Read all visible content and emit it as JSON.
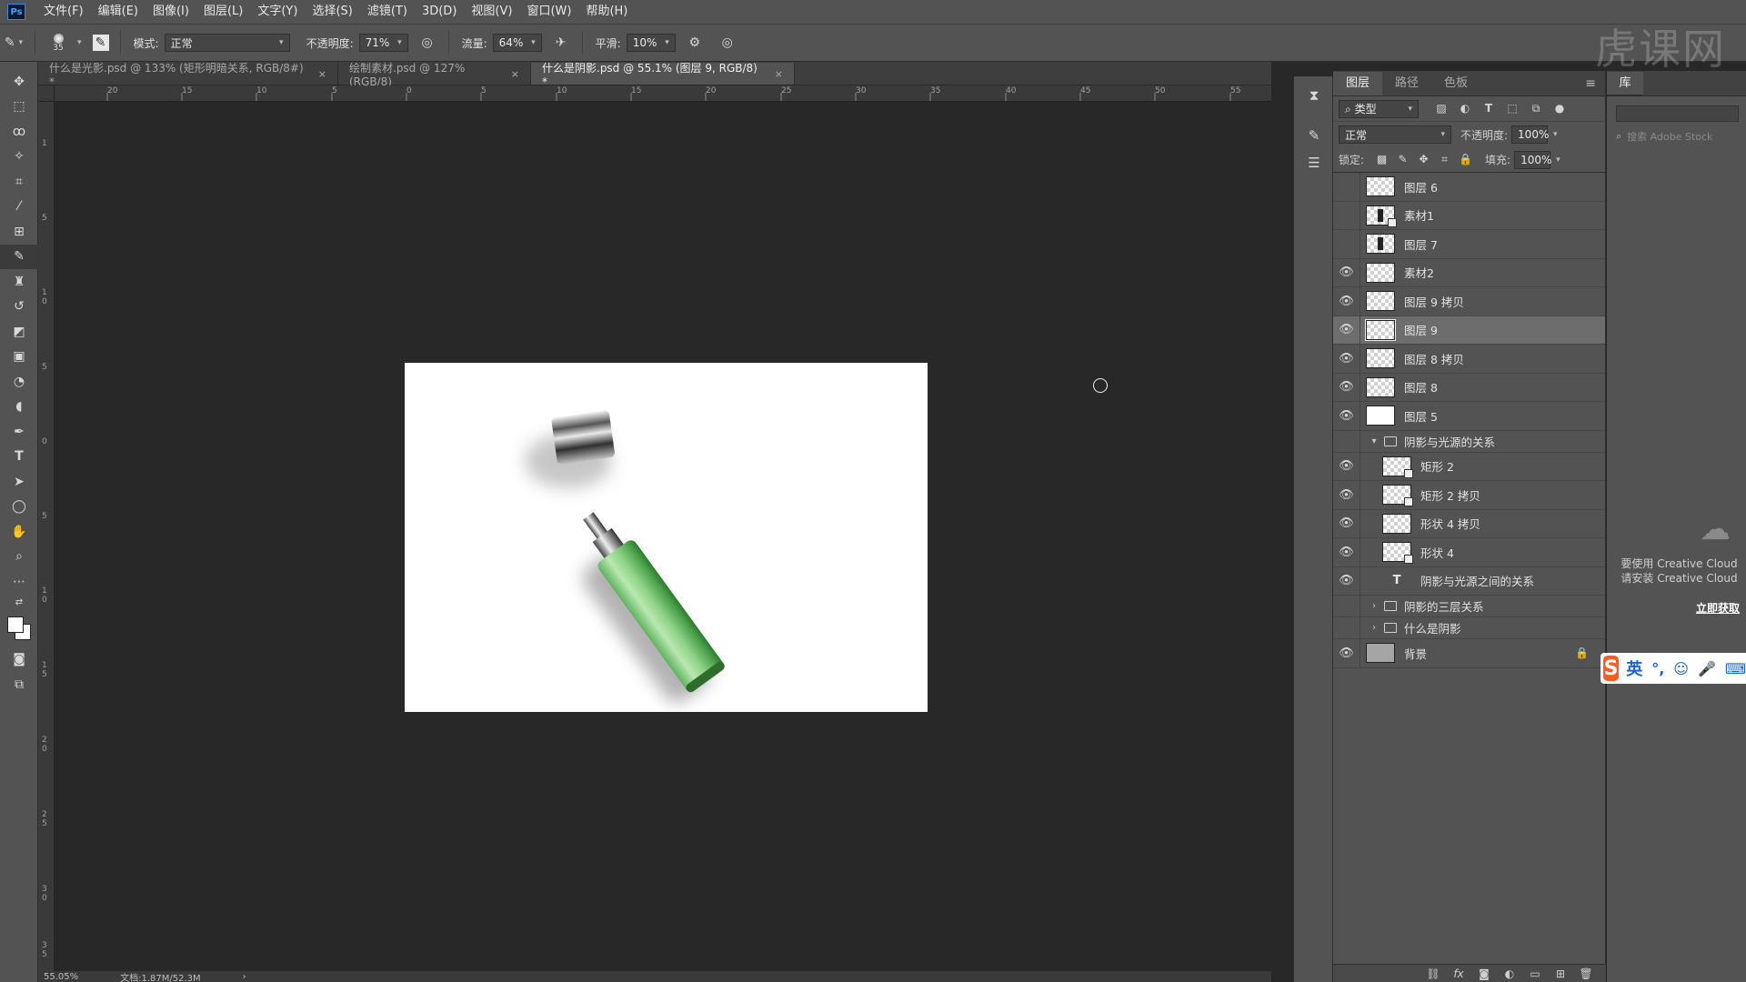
{
  "menu": {
    "app_badge": "Ps",
    "items": [
      "文件(F)",
      "编辑(E)",
      "图像(I)",
      "图层(L)",
      "文字(Y)",
      "选择(S)",
      "滤镜(T)",
      "3D(D)",
      "视图(V)",
      "窗口(W)",
      "帮助(H)"
    ]
  },
  "options": {
    "brush_size": "35",
    "mode_label": "模式:",
    "mode_value": "正常",
    "opacity_label": "不透明度:",
    "opacity_value": "71%",
    "flow_label": "流量:",
    "flow_value": "64%",
    "smooth_label": "平滑:",
    "smooth_value": "10%"
  },
  "watermark": "虎课网",
  "tabs": [
    {
      "label": "什么是光影.psd @ 133% (矩形明暗关系, RGB/8#) *",
      "close": "×"
    },
    {
      "label": "绘制素材.psd @ 127%(RGB/8)",
      "close": "×"
    },
    {
      "label": "什么是阴影.psd @ 55.1% (图层 9, RGB/8) *",
      "close": "×"
    }
  ],
  "ruler_top": [
    "20",
    "15",
    "10",
    "5",
    "0",
    "5",
    "10",
    "15",
    "20",
    "25",
    "30",
    "35",
    "40",
    "45",
    "50",
    "55"
  ],
  "ruler_left": [
    "1",
    "5",
    "1",
    "0",
    "5",
    "0",
    "5",
    "1",
    "0",
    "1",
    "5",
    "2",
    "0",
    "2",
    "5",
    "3",
    "0",
    "3",
    "5"
  ],
  "status": {
    "zoom": "55.05%",
    "doc": "文档:1.87M/52.3M",
    "arrow": "›"
  },
  "layers_panel": {
    "tabs": [
      "图层",
      "路径",
      "色板"
    ],
    "menu_icon": "≡",
    "filter_label": "类型",
    "blend_mode": "正常",
    "opacity_label": "不透明度:",
    "opacity_value": "100%",
    "lock_label": "锁定:",
    "fill_label": "填充:",
    "fill_value": "100%",
    "layers": [
      {
        "name": "图层 6",
        "visible": false,
        "thumb": "checker"
      },
      {
        "name": "素材1",
        "visible": false,
        "thumb": "checker-dark"
      },
      {
        "name": "图层 7",
        "visible": false,
        "thumb": "checker-dark"
      },
      {
        "name": "素材2",
        "visible": true,
        "thumb": "checker"
      },
      {
        "name": "图层 9 拷贝",
        "visible": true,
        "thumb": "checker"
      },
      {
        "name": "图层 9",
        "visible": true,
        "thumb": "checker",
        "selected": true
      },
      {
        "name": "图层 8 拷贝",
        "visible": true,
        "thumb": "checker"
      },
      {
        "name": "图层 8",
        "visible": true,
        "thumb": "checker"
      },
      {
        "name": "图层 5",
        "visible": true,
        "thumb": "white"
      }
    ],
    "group_open": {
      "name": "阴影与光源的关系",
      "visible": false
    },
    "group_children": [
      {
        "name": "矩形 2",
        "visible": true,
        "kind": "shape"
      },
      {
        "name": "矩形 2 拷贝",
        "visible": true,
        "kind": "shape"
      },
      {
        "name": "形状 4 拷贝",
        "visible": true,
        "kind": "checker"
      },
      {
        "name": "形状 4",
        "visible": true,
        "kind": "shape"
      },
      {
        "name": "阴影与光源之间的关系",
        "visible": true,
        "kind": "text"
      }
    ],
    "groups_closed": [
      {
        "name": "阴影的三层关系",
        "visible": false
      },
      {
        "name": "什么是阴影",
        "visible": false
      }
    ],
    "background": {
      "name": "背景",
      "visible": true
    }
  },
  "library": {
    "tab": "库",
    "search_placeholder": "搜索 Adobe Stock",
    "message_line1": "要使用 Creative Cloud",
    "message_line2": "请安装 Creative Cloud",
    "link": "立即获取"
  },
  "ime": {
    "lang": "英"
  }
}
